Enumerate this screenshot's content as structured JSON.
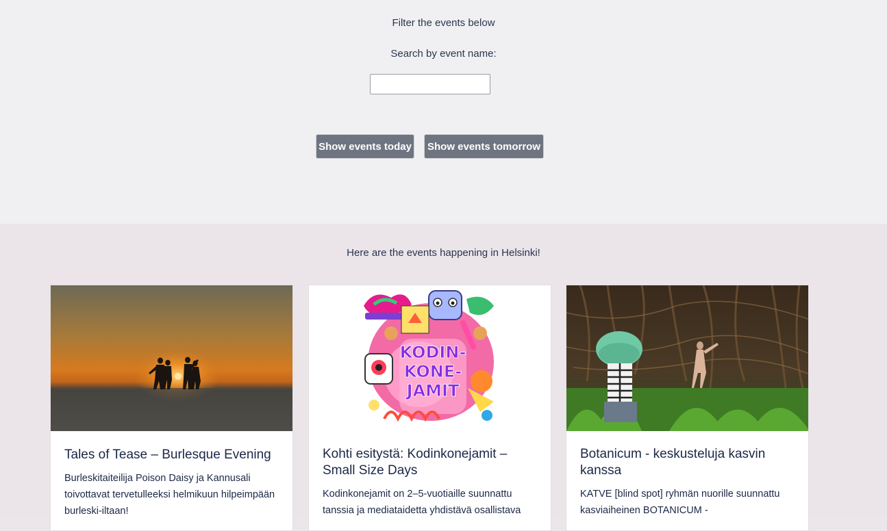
{
  "filter": {
    "title": "Filter the events below",
    "search_label": "Search by event name:",
    "search_value": "",
    "search_placeholder": "",
    "today_label": "Show events today",
    "tomorrow_label": "Show events tomorrow"
  },
  "events": {
    "heading": "Here are the events happening in Helsinki!",
    "items": [
      {
        "title": "Tales of Tease – Burlesque Evening",
        "description": "Burleskitaiteilija Poison Daisy ja Kannusali toivottavat tervetulleeksi helmikuun hilpeimpään burleski-iltaan!",
        "image": "sunset-silhouettes-image"
      },
      {
        "title": "Kohti esitystä: Kodinkonejamit – Small Size Days",
        "description": "Kodinkonejamit on 2–5-vuotiaille suunnattu tanssia ja mediataidetta yhdistävä osallistava",
        "image": "kodinkonejamit-illustration",
        "image_text": "KODIN-KONE-JAMIT"
      },
      {
        "title": "Botanicum - keskusteluja kasvin kanssa",
        "description": "KATVE [blind spot] ryhmän nuorille suunnattu kasviaiheinen BOTANICUM -",
        "image": "forest-performers-image"
      }
    ]
  }
}
